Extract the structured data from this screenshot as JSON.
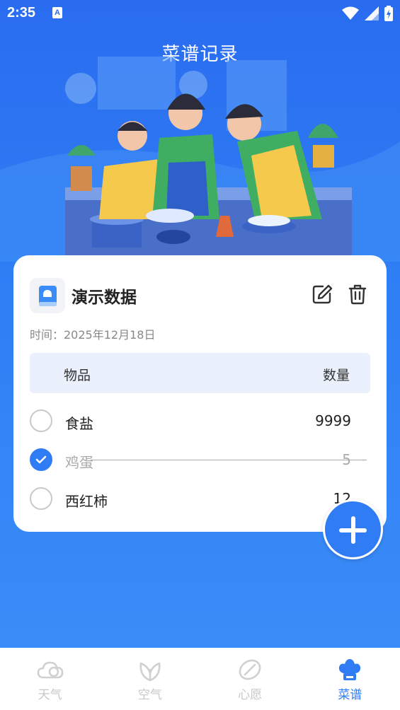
{
  "status_bar": {
    "time": "2:35",
    "a_icon": "A"
  },
  "header": {
    "title": "菜谱记录"
  },
  "card": {
    "title": "演示数据",
    "date": "时间：2025年12月18日",
    "columns": {
      "item": "物品",
      "quantity": "数量"
    },
    "rows": [
      {
        "name": "食盐",
        "quantity": "9999",
        "checked": false
      },
      {
        "name": "鸡蛋",
        "quantity": "5",
        "checked": true
      },
      {
        "name": "西红柿",
        "quantity": "12",
        "checked": false
      }
    ]
  },
  "nav": {
    "items": [
      {
        "label": "天气",
        "icon": "cloud-icon",
        "active": false
      },
      {
        "label": "空气",
        "icon": "leaf-icon",
        "active": false
      },
      {
        "label": "心愿",
        "icon": "wish-icon",
        "active": false
      },
      {
        "label": "菜谱",
        "icon": "chef-hat-icon",
        "active": true
      }
    ]
  },
  "colors": {
    "primary": "#2f7cf5",
    "background": "#2a6cf0",
    "inactive": "#c8c8c8"
  }
}
